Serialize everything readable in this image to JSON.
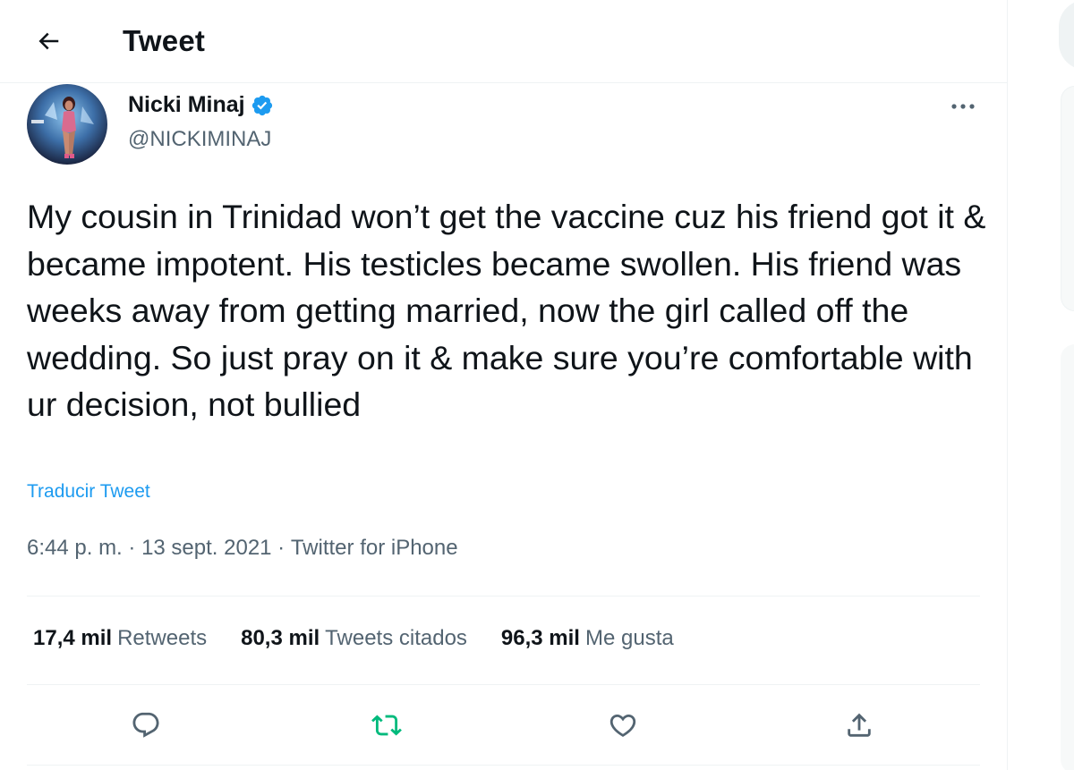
{
  "header": {
    "back_icon": "arrow-left-icon",
    "title": "Tweet"
  },
  "tweet": {
    "author": {
      "display_name": "Nicki Minaj",
      "handle": "@NICKIMINAJ",
      "verified": true,
      "verified_color": "#1d9bf0"
    },
    "more_icon": "more-horizontal-icon",
    "text": "My cousin in Trinidad won’t get the vaccine cuz his friend got it & became impotent. His testicles became swollen. His friend was weeks away from getting married, now the girl called off the wedding. So just pray on it & make sure you’re comfortable with ur decision, not bullied",
    "translate_label": "Traducir Tweet",
    "time": "6:44 p. m.",
    "separator": " · ",
    "date": "13 sept. 2021",
    "source": "Twitter for iPhone"
  },
  "stats": {
    "retweets_count": "17,4 mil",
    "retweets_label": "Retweets",
    "quotes_count": "80,3 mil",
    "quotes_label": "Tweets citados",
    "likes_count": "96,3 mil",
    "likes_label": "Me gusta"
  },
  "actions": {
    "reply_icon": "reply-icon",
    "retweet_icon": "retweet-icon",
    "like_icon": "heart-icon",
    "share_icon": "share-icon",
    "retweet_active_color": "#00ba7c"
  },
  "colors": {
    "accent": "#1d9bf0",
    "secondary_text": "#536471",
    "primary_text": "#0f1419",
    "border": "#eff3f4"
  }
}
